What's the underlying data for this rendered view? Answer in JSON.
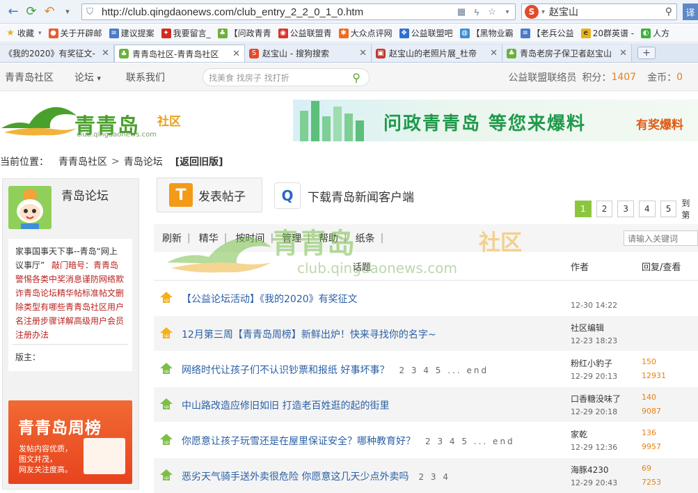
{
  "browser": {
    "url": "http://club.qingdaonews.com/club_entry_2_2_0_1_0.htm",
    "search_query": "赵宝山",
    "translate_label": "译",
    "bookmarks": [
      "收藏",
      "关于开辟邮",
      "建议提案",
      "我要留言_",
      "【问政青青",
      "公益联盟青",
      "大众点评网",
      "公益联盟吧",
      "【黑物业霸",
      "【老兵公益",
      "20群英谱 -",
      "人方"
    ],
    "tabs": [
      {
        "label": "《我的2020》有奖征文-"
      },
      {
        "label": "青青岛社区-青青岛社区"
      },
      {
        "label": "赵宝山 - 搜狗搜索"
      },
      {
        "label": "赵宝山的老照片展_杜帝"
      },
      {
        "label": "青岛老房子保卫者赵宝山"
      }
    ],
    "new_tab": "+"
  },
  "site": {
    "nav": {
      "home": "青青岛社区",
      "forum": "论坛",
      "forum_arrow": "▾",
      "about": "联系我们"
    },
    "search_placeholder": "找美食 找房子 找打折",
    "user": {
      "name": "公益联盟联络员",
      "points_label": "积分：",
      "points": "1407",
      "coins_label": "金币：",
      "coins": "0"
    },
    "logo": {
      "title": "青青岛",
      "suffix": "社区",
      "url": "club.qingdaonews.com"
    },
    "banner": {
      "text": "问政青青岛 等您来爆料",
      "reward": "有奖爆料"
    }
  },
  "breadcrumb": {
    "label": "当前位置：",
    "items": [
      "青青岛社区",
      "青岛论坛"
    ],
    "sep": ">",
    "back": "[返回旧版]"
  },
  "sidebar": {
    "forum_name": "青岛论坛",
    "desc_intro": "家事国事天下事--青岛“网上议事厅”",
    "desc_links": "敲门暗号：青青岛警惕各类中奖消息谨防网络欺诈青岛论坛精华帖标准帖文删除类型有哪些青青岛社区用户名注册步骤详解高级用户会员注册办法",
    "moderators_label": "版主：",
    "promo": {
      "title": "青青岛周榜",
      "line1": "发帖内容优质，",
      "line2": "图文并茂，",
      "line3": "网友关注度高。"
    }
  },
  "main": {
    "post_button": "发表帖子",
    "post_icon": "T",
    "app_download": "下载青岛新闻客户端",
    "pager": {
      "pages": [
        "1",
        "2",
        "3",
        "4",
        "5"
      ],
      "current": "1",
      "goto": "到第"
    },
    "toolbar": [
      "刷新",
      "精华",
      "按时间",
      "管理",
      "帮助",
      "纸条"
    ],
    "toolbar_sep": "|",
    "keyword_placeholder": "请输入关键词",
    "watermark": {
      "title": "青青岛",
      "suffix": "社区",
      "url": "club.qingdaonews.com"
    },
    "columns": {
      "topic": "话题",
      "author": "作者",
      "replies": "回复/查看"
    },
    "threads": [
      {
        "title": "【公益论坛活动】《我的2020》有奖征文",
        "pages": "",
        "author": "",
        "date": "12-30 14:22",
        "replies": "",
        "views": "",
        "pinned": true
      },
      {
        "title": "12月第三周【青青岛周榜】新鲜出炉！快来寻找你的名字~",
        "pages": "",
        "author": "社区编辑",
        "date": "12-23 18:23",
        "replies": "",
        "views": "",
        "pinned": true
      },
      {
        "title": "网络时代让孩子们不认识钞票和报纸 好事坏事？",
        "pages": "2 3 4 5 ... end",
        "author": "粉红小豹子",
        "date": "12-29 20:13",
        "replies": "150",
        "views": "12931",
        "pinned": false
      },
      {
        "title": "中山路改造应修旧如旧 打造老百姓逛的起的街里",
        "pages": "",
        "author": "口香糖没味了",
        "date": "12-29 20:18",
        "replies": "140",
        "views": "9087",
        "pinned": false
      },
      {
        "title": "你愿意让孩子玩雪还是在屋里保证安全？哪种教育好？",
        "pages": "2 3 4 5 ... end",
        "author": "家乾",
        "date": "12-29 12:36",
        "replies": "136",
        "views": "9957",
        "pinned": false
      },
      {
        "title": "恶劣天气骑手送外卖很危险 你愿意这几天少点外卖吗",
        "pages": "2 3 4",
        "author": "海豚4230",
        "date": "12-29 20:43",
        "replies": "69",
        "views": "7253",
        "pinned": false
      }
    ]
  },
  "colors": {
    "green": "#8cc63f",
    "orange": "#e58217",
    "link_red": "#b8221f",
    "title_blue": "#2a5fa5"
  }
}
